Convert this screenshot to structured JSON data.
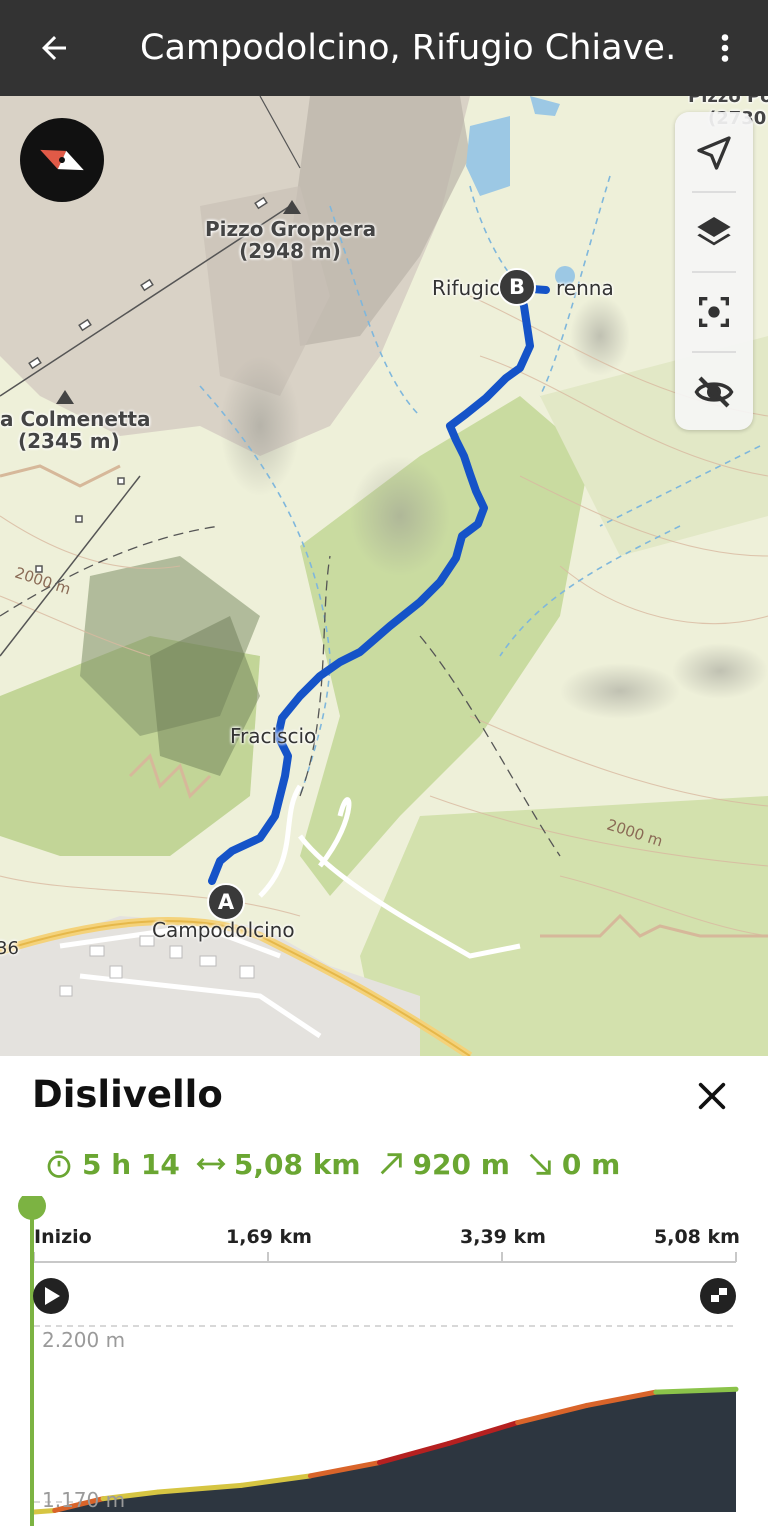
{
  "header": {
    "title": "Campodolcino, Rifugio Chiave…",
    "back_icon": "arrow-left-icon",
    "menu_icon": "more-vertical-icon"
  },
  "map": {
    "peaks": [
      {
        "name": "Pizzo Groppera",
        "elevation": "(2948 m)"
      },
      {
        "name": "a Colmenetta",
        "elevation": "(2345 m)"
      },
      {
        "name": "Pizzo Po",
        "elevation": "(2730"
      }
    ],
    "places": {
      "refuge": "Rifugio",
      "refuge_suffix": "renna",
      "village": "Fraciscio",
      "town": "Campodolcino"
    },
    "road_number": "36",
    "contours": [
      "2000 m",
      "2000 m"
    ],
    "markers": {
      "start": "A",
      "end": "B"
    },
    "colors": {
      "route": "#1553c8",
      "terrain": "#eef0d9",
      "forest": "#c9dba0",
      "water": "#9cc8e4"
    }
  },
  "map_tools": [
    {
      "name": "locate-icon"
    },
    {
      "name": "layers-icon"
    },
    {
      "name": "focus-icon"
    },
    {
      "name": "eye-off-icon"
    }
  ],
  "panel": {
    "title": "Dislivello",
    "close_icon": "close-icon",
    "stats": {
      "duration": "5 h 14",
      "distance": "5,08 km",
      "ascent": "920 m",
      "descent": "0 m"
    },
    "stat_icons": [
      "timer-icon",
      "distance-icon",
      "ascent-icon",
      "descent-icon"
    ],
    "accent": "#6aa632"
  },
  "chart_data": {
    "type": "area",
    "x_ticks": [
      "Inizio",
      "1,69 km",
      "3,39 km",
      "5,08 km"
    ],
    "y_labels": [
      "2.200 m",
      "1.170 m"
    ],
    "ylim": [
      1170,
      2200
    ],
    "xlim": [
      0,
      5.08
    ],
    "x": [
      0,
      0.15,
      0.5,
      0.9,
      1.5,
      2.0,
      2.5,
      3.0,
      3.5,
      4.0,
      4.5,
      5.08
    ],
    "y": [
      1170,
      1178,
      1240,
      1275,
      1310,
      1360,
      1430,
      1530,
      1640,
      1730,
      1800,
      1815
    ],
    "fill_color": "#2d3640",
    "slider_position": 0
  }
}
